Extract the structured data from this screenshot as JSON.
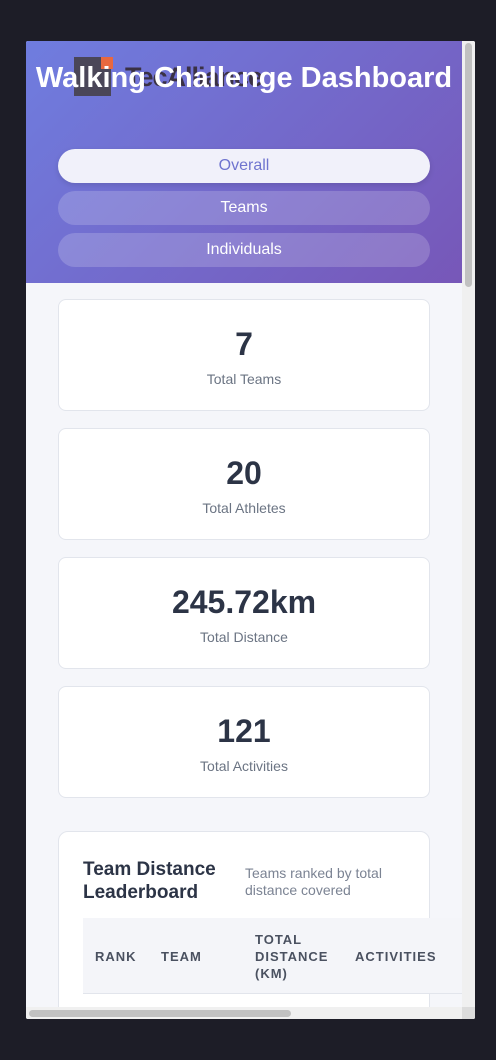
{
  "header": {
    "logo_text": "TecAlliance",
    "title": "Walking Challenge Dashboard"
  },
  "tabs": [
    {
      "label": "Overall",
      "active": true
    },
    {
      "label": "Teams",
      "active": false
    },
    {
      "label": "Individuals",
      "active": false
    }
  ],
  "stats": [
    {
      "value": "7",
      "label": "Total Teams"
    },
    {
      "value": "20",
      "label": "Total Athletes"
    },
    {
      "value": "245.72km",
      "label": "Total Distance"
    },
    {
      "value": "121",
      "label": "Total Activities"
    }
  ],
  "leaderboard": {
    "title": "Team Distance Leaderboard",
    "subtitle": "Teams ranked by total distance covered",
    "columns": [
      "RANK",
      "TEAM",
      "TOTAL DISTANCE (KM)",
      "ACTIVITIES"
    ]
  },
  "colors": {
    "hero_start": "#6f7ddf",
    "hero_end": "#7757b8",
    "logo_accent": "#e8683f",
    "active_tab_text": "#6f74cf"
  }
}
